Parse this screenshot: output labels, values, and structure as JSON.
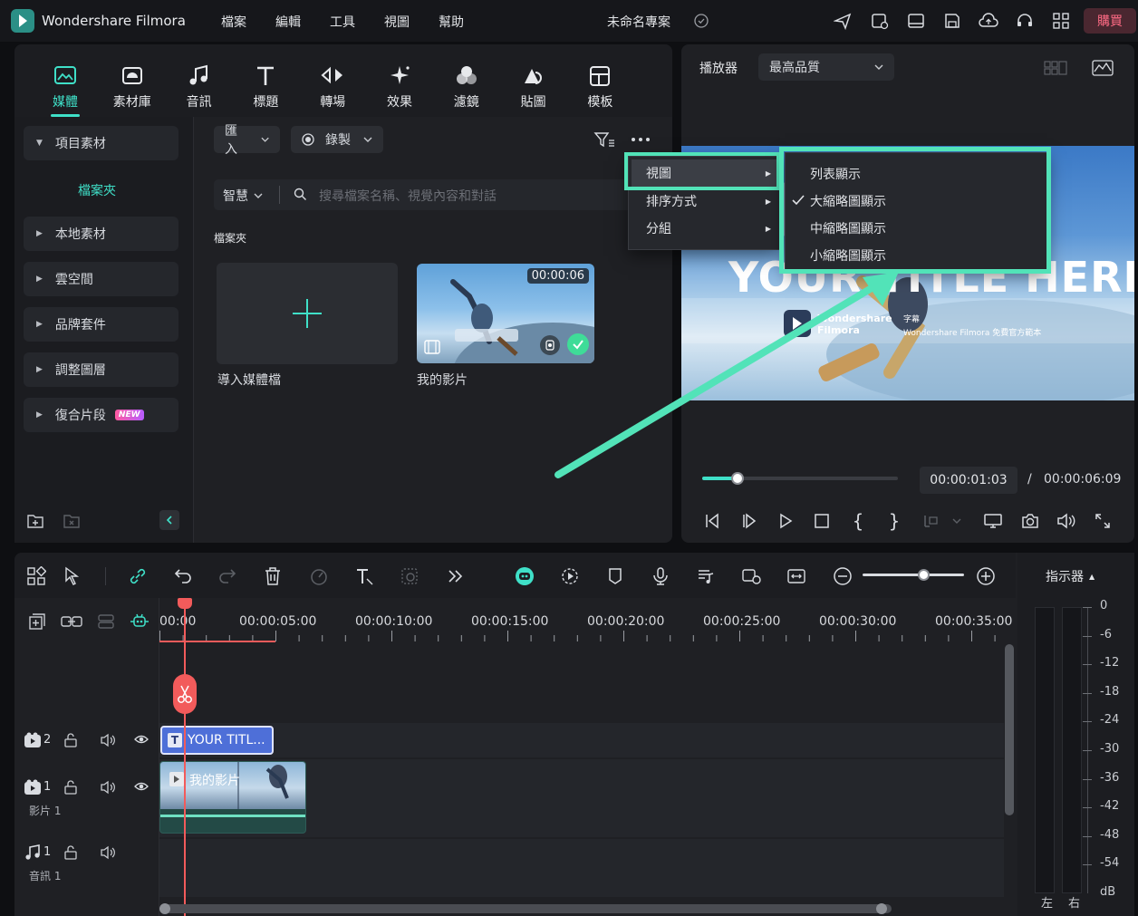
{
  "app": {
    "title": "Wondershare Filmora",
    "project_name": "未命名專案",
    "buy_label": "購買"
  },
  "menu": [
    "檔案",
    "編輯",
    "工具",
    "視圖",
    "幫助"
  ],
  "media_tabs": [
    {
      "label": "媒體",
      "icon": "media-icon",
      "active": true
    },
    {
      "label": "素材庫",
      "icon": "stock-icon"
    },
    {
      "label": "音訊",
      "icon": "music-note-icon"
    },
    {
      "label": "標題",
      "icon": "title-t-icon"
    },
    {
      "label": "轉場",
      "icon": "transition-icon"
    },
    {
      "label": "效果",
      "icon": "effects-sparkle-icon"
    },
    {
      "label": "濾鏡",
      "icon": "filter-icon"
    },
    {
      "label": "貼圖",
      "icon": "sticker-icon"
    },
    {
      "label": "模板",
      "icon": "template-icon"
    }
  ],
  "sidebar": {
    "project_media": "項目素材",
    "folder": "檔案夾",
    "items": [
      "本地素材",
      "雲空間",
      "品牌套件",
      "調整圖層",
      "復合片段"
    ],
    "new_badge": "NEW"
  },
  "media_toolbar": {
    "import_label": "匯入",
    "record_label": "錄製",
    "smart_label": "智慧",
    "search_placeholder": "搜尋檔案名稱、視覺內容和對話"
  },
  "media_area": {
    "section_title": "檔案夾",
    "import_card_label": "導入媒體檔",
    "video_card": {
      "label": "我的影片",
      "duration": "00:00:06"
    }
  },
  "context_menu": {
    "items": [
      "視圖",
      "排序方式",
      "分組"
    ],
    "submenu": [
      {
        "label": "列表顯示",
        "checked": false
      },
      {
        "label": "大縮略圖顯示",
        "checked": true
      },
      {
        "label": "中縮略圖顯示",
        "checked": false
      },
      {
        "label": "小縮略圖顯示",
        "checked": false
      }
    ]
  },
  "preview": {
    "player_label": "播放器",
    "quality": "最高品質",
    "title_overlay": "YOUR TITLE HERE",
    "logo_text_1": "Wondershare",
    "logo_text_2": "Filmora",
    "caption_1": "字幕",
    "caption_2": "Wondershare Filmora 免費官方範本",
    "current_time": "00:00:01:03",
    "separator": "/",
    "total_time": "00:00:06:09",
    "progress": 0.18
  },
  "timeline": {
    "ruler": [
      "00:00",
      "00:00:05:00",
      "00:00:10:00",
      "00:00:15:00",
      "00:00:20:00",
      "00:00:25:00",
      "00:00:30:00",
      "00:00:35:00"
    ],
    "tracks": [
      {
        "num": "2",
        "name": ""
      },
      {
        "num": "1",
        "name": "影片 1"
      },
      {
        "num": "1",
        "name": "音訊 1"
      }
    ],
    "title_clip": "YOUR TITL...",
    "video_clip": "我的影片",
    "indicator_label": "指示器",
    "db_scale": [
      "0",
      "-6",
      "-12",
      "-18",
      "-24",
      "-30",
      "-36",
      "-42",
      "-48",
      "-54",
      "dB"
    ],
    "meter_left": "左",
    "meter_right": "右"
  },
  "colors": {
    "accent": "#3fe0c8",
    "playhead": "#f25b5b",
    "buy": "#ff6b85",
    "highlight": "#52e3b8"
  }
}
